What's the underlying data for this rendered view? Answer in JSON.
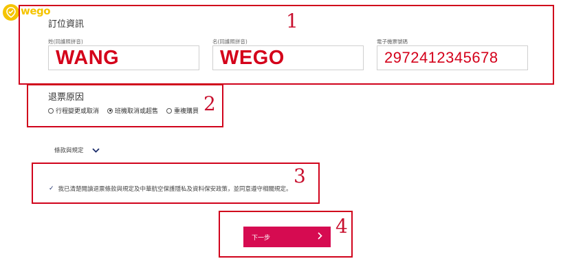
{
  "brand": {
    "logo_text": "wego",
    "color": "#f5c400"
  },
  "annotations": [
    "1",
    "2",
    "3",
    "4"
  ],
  "booking": {
    "title": "訂位資訊",
    "fields": [
      {
        "label": "姓(同護照拼音)",
        "value": "WANG"
      },
      {
        "label": "名(同護照拼音)",
        "value": "WEGO"
      },
      {
        "label": "電子機票號碼",
        "value": "2972412345678"
      }
    ]
  },
  "refund_reason": {
    "title": "退票原因",
    "options": [
      {
        "label": "行程變更或取消",
        "selected": false
      },
      {
        "label": "班機取消或超售",
        "selected": true
      },
      {
        "label": "重複購買",
        "selected": false
      }
    ]
  },
  "terms": {
    "link_label": "條款與規定"
  },
  "agreement": {
    "checked": true,
    "text": "我已清楚閱讀退票條款與規定及中華航空保護隱私及資料保安政策，並同意遵守相關規定。"
  },
  "next_button": {
    "label": "下一步",
    "color": "#d60b51"
  },
  "colors": {
    "annotation": "#d0021b",
    "navy": "#1b2d6b"
  }
}
